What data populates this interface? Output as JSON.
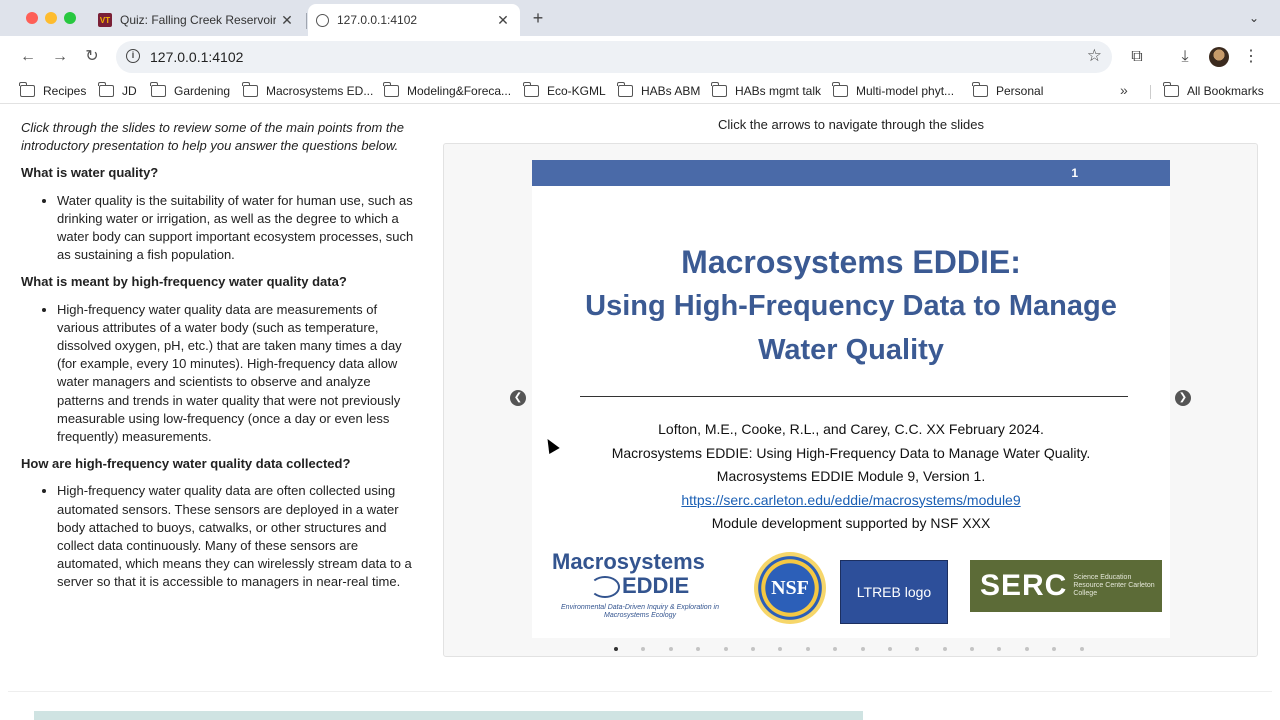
{
  "browser": {
    "tabs": [
      {
        "title": "Quiz: Falling Creek Reservoir",
        "favicon": "vt-logo-icon",
        "active": false
      },
      {
        "title": "127.0.0.1:4102",
        "favicon": "globe-icon",
        "active": true
      }
    ],
    "url": "127.0.0.1:4102",
    "bookmarks": [
      "Recipes",
      "JD",
      "Gardening",
      "Macrosystems ED...",
      "Modeling&Foreca...",
      "Eco-KGML",
      "HABs ABM",
      "HABs mgmt talk",
      "Multi-model phyt...",
      "Personal"
    ],
    "all_bookmarks": "All Bookmarks"
  },
  "page": {
    "intro": "Click through the slides to review some of the main points from the introductory presentation to help you answer the questions below.",
    "sections": [
      {
        "heading": "What is water quality?",
        "bullet": "Water quality is the suitability of water for human use, such as drinking water or irrigation, as well as the degree to which a water body can support important ecosystem processes, such as sustaining a fish population."
      },
      {
        "heading": "What is meant by high-frequency water quality data?",
        "bullet": "High-frequency water quality data are measurements of various attributes of a water body (such as temperature, dissolved oxygen, pH, etc.) that are taken many times a day (for example, every 10 minutes). High-frequency data allow water managers and scientists to observe and analyze patterns and trends in water quality that were not previously measurable using low-frequency (once a day or even less frequently) measurements."
      },
      {
        "heading": "How are high-frequency water quality data collected?",
        "bullet": "High-frequency water quality data are often collected using automated sensors. These sensors are deployed in a water body attached to buoys, catwalks, or other structures and collect data continuously. Many of these sensors are automated, which means they can wirelessly stream data to a server so that it is accessible to managers in near-real time."
      }
    ],
    "carousel": {
      "caption": "Click the arrows to navigate through the slides",
      "slide_number": "1",
      "title_line1": "Macrosystems EDDIE:",
      "title_line2": "Using High-Frequency Data to Manage",
      "title_line3": "Water Quality",
      "cite_line1": "Lofton, M.E., Cooke, R.L., and Carey, C.C. XX February 2024.",
      "cite_line2": "Macrosystems EDDIE: Using High-Frequency Data to Manage Water Quality.",
      "cite_line3": "Macrosystems EDDIE Module 9, Version 1.",
      "link": "https://serc.carleton.edu/eddie/macrosystems/module9",
      "cite_line5": "Module development supported by NSF XXX",
      "logo_eddie_line1": "Macrosystems",
      "logo_eddie_line2": "EDDIE",
      "logo_eddie_sub": "Environmental Data-Driven Inquiry & Exploration in Macrosystems Ecology",
      "logo_nsf": "NSF",
      "logo_ltreb": "LTREB logo",
      "logo_serc": "SERC",
      "logo_serc_sub": "Science Education Resource Center Carleton College",
      "total_slides": 18,
      "current_slide": 1
    }
  }
}
